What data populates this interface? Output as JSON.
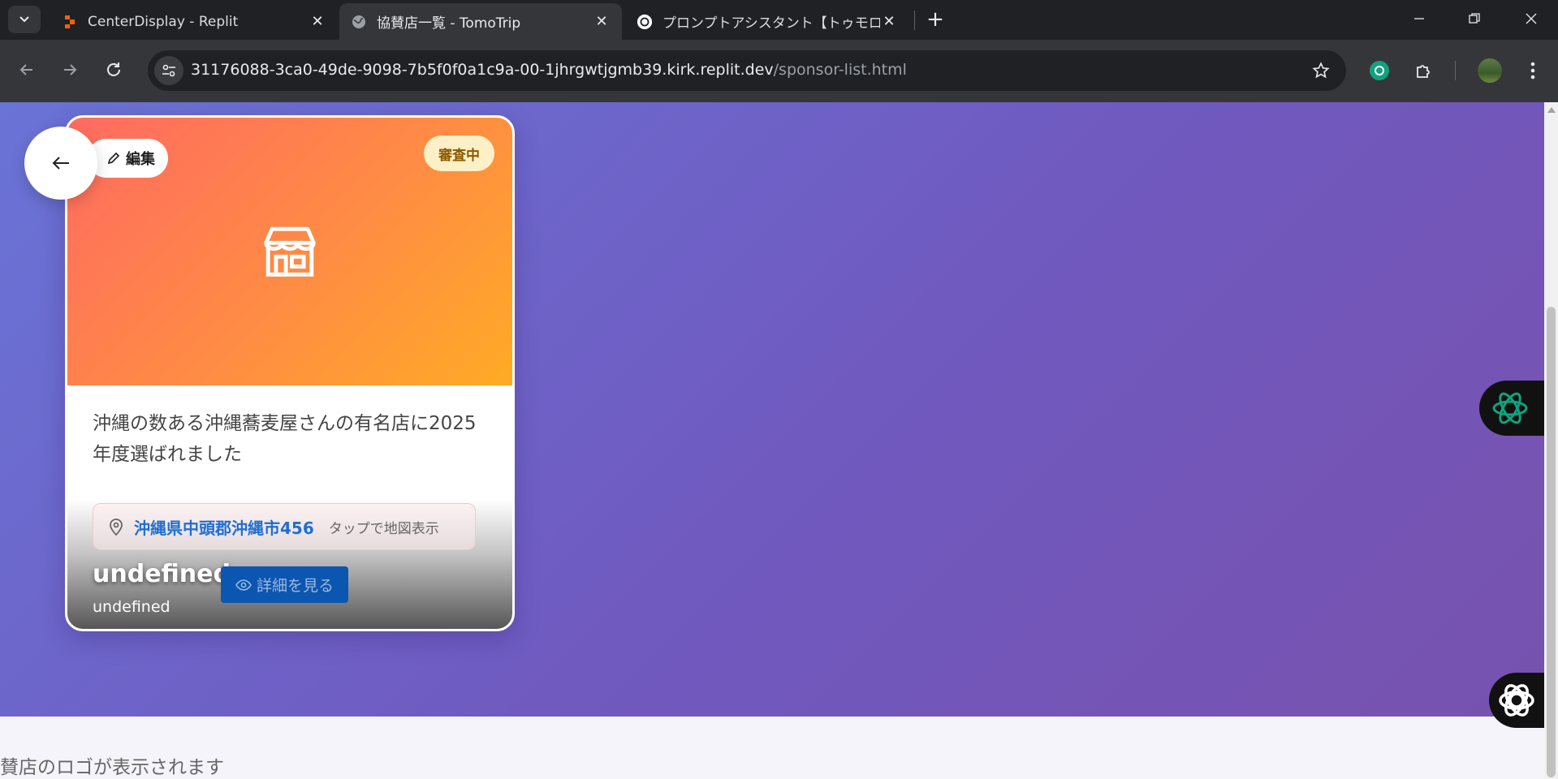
{
  "browser": {
    "tabs": [
      {
        "title": "CenterDisplay - Replit",
        "active": false,
        "icon": "replit-icon"
      },
      {
        "title": "協賛店一覧 - TomoTrip",
        "active": true,
        "icon": "globe-icon"
      },
      {
        "title": "プロンプトアシスタント【トゥモローブル-",
        "active": false,
        "icon": "openai-icon"
      }
    ],
    "url_host": "31176088-3ca0-49de-9098-7b5f0f0a1c9a-00-1jhrgwtjgmb39.kirk.replit.dev",
    "url_path": "/sponsor-list.html"
  },
  "page": {
    "card": {
      "edit_label": "編集",
      "status_label": "審査中",
      "description": "沖縄の数ある沖縄蕎麦屋さんの有名店に2025年度選ばれました",
      "address": "沖縄県中頭郡沖縄市456",
      "map_hint": "タップで地図表示",
      "name": "undefined",
      "subtitle": "undefined",
      "detail_label": "詳細を見る"
    },
    "bottom_text": "賛店のロゴが表示されます"
  },
  "colors": {
    "hero_start": "#6a73d6",
    "hero_end": "#7752ae",
    "card_gradient_start": "#ff6b61",
    "card_gradient_end": "#ffab25",
    "status_bg": "#fdf0c6",
    "link_blue": "#1f6fd1",
    "button_blue": "#0b56b0"
  }
}
